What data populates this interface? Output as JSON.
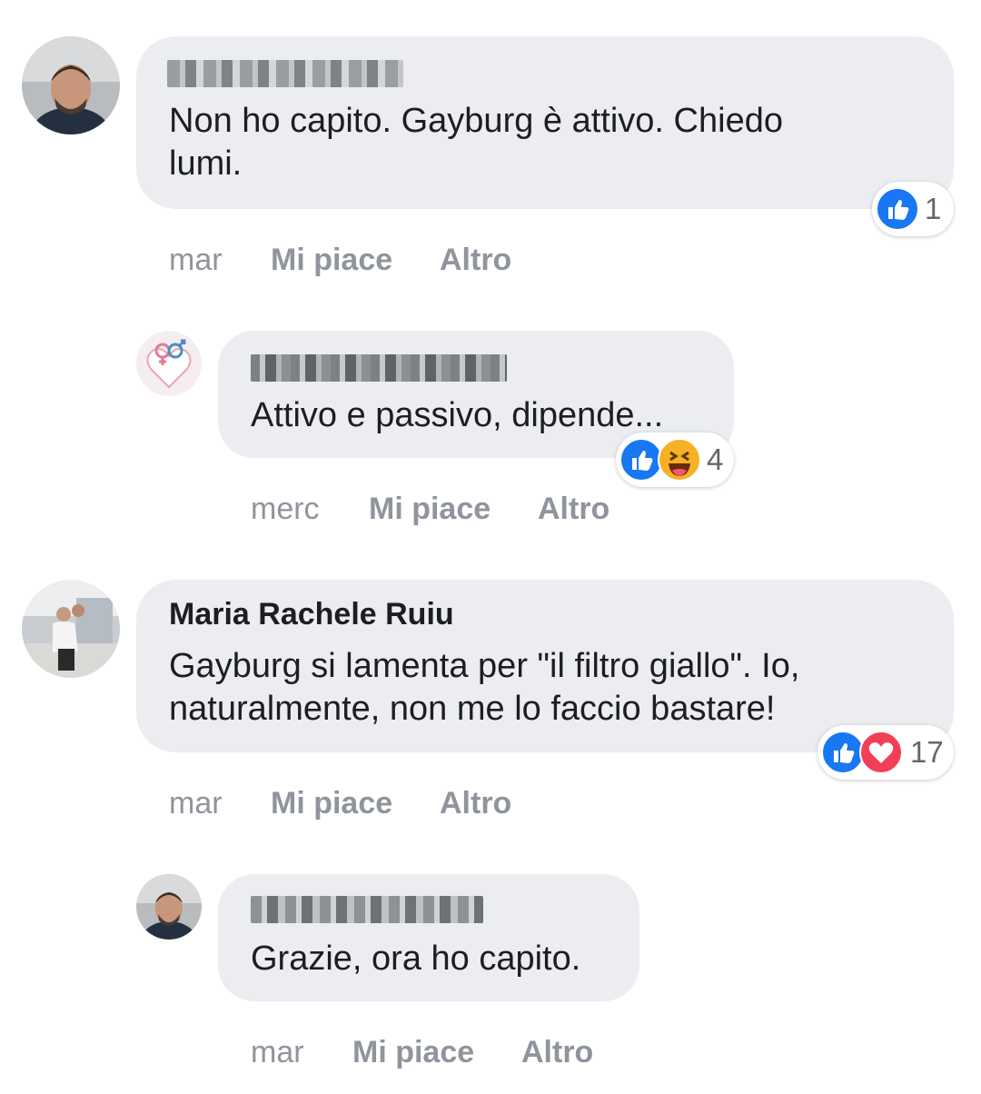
{
  "comments": [
    {
      "name": "",
      "text_lines": [
        "Non ho capito. Gayburg è attivo. Chiedo",
        "lumi."
      ],
      "reaction_count": "1",
      "time": "mar",
      "like_label": "Mi piace",
      "more_label": "Altro"
    },
    {
      "name": "",
      "text_lines": [
        "Attivo e passivo, dipende..."
      ],
      "reaction_count": "4",
      "time": "merc",
      "like_label": "Mi piace",
      "more_label": "Altro"
    },
    {
      "name": "Maria Rachele Ruiu",
      "text_lines": [
        "Gayburg si lamenta per \"il filtro giallo\". Io,",
        "naturalmente, non me lo faccio bastare!"
      ],
      "reaction_count": "17",
      "time": "mar",
      "like_label": "Mi piace",
      "more_label": "Altro"
    },
    {
      "name": "",
      "text_lines": [
        "Grazie, ora ho capito."
      ],
      "reaction_count": "",
      "time": "mar",
      "like_label": "Mi piace",
      "more_label": "Altro"
    }
  ],
  "icons": {
    "like": "like-icon",
    "love": "love-icon",
    "haha": "haha-icon"
  },
  "colors": {
    "bubble": "#ebedf0",
    "like_blue": "#1877f2",
    "love_red": "#f33e58",
    "haha_yellow": "#f7b125",
    "meta_gray": "#90949c"
  }
}
